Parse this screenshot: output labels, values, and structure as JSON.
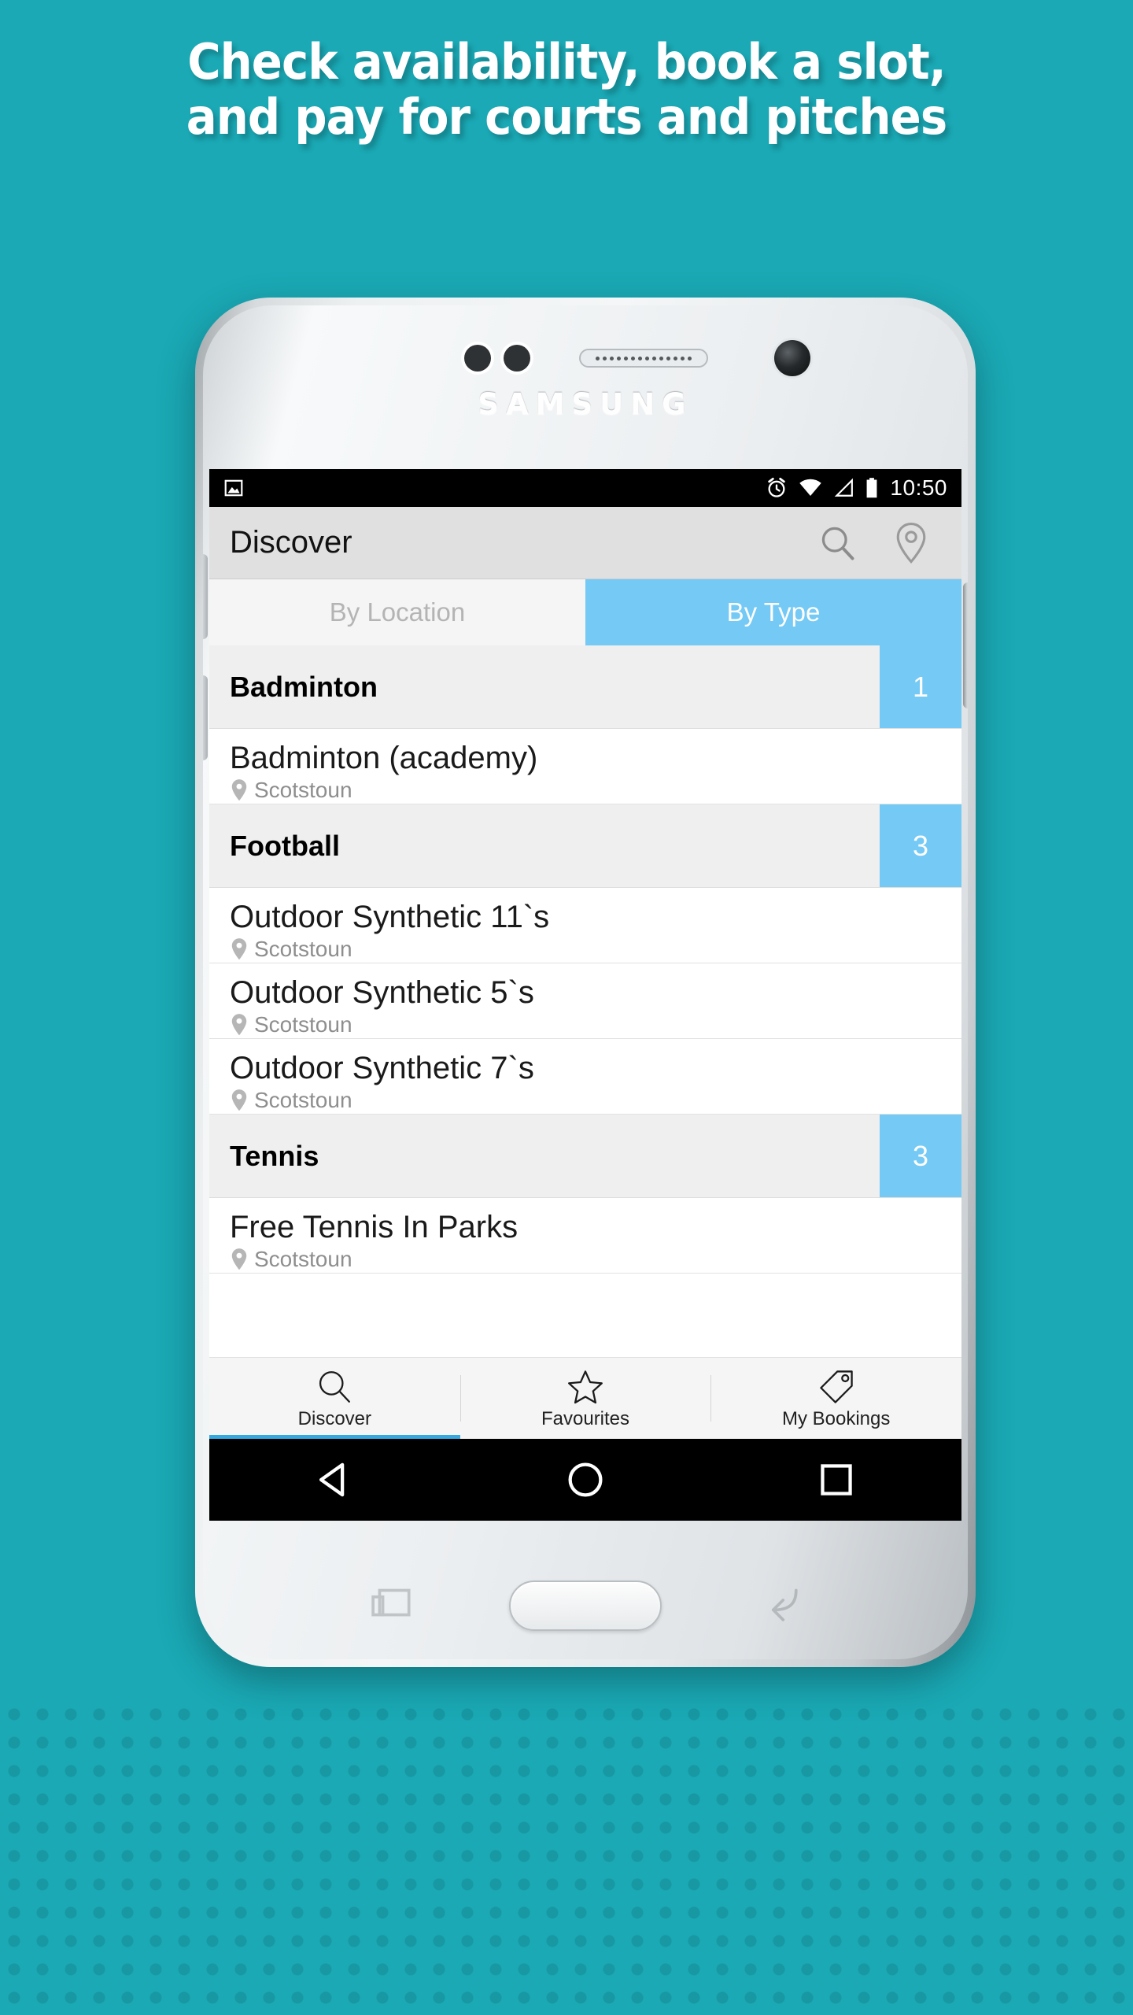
{
  "promo": {
    "background_color": "#1aa9b5",
    "headline_line_1": "Check availability, book a slot,",
    "headline_line_2": "and pay for courts and pitches"
  },
  "device": {
    "brand": "SAMSUNG"
  },
  "statusbar": {
    "time": "10:50",
    "icons": [
      "image-icon",
      "alarm-icon",
      "wifi-icon",
      "signal-icon",
      "battery-icon"
    ]
  },
  "appbar": {
    "title": "Discover",
    "actions": [
      "search-icon",
      "location-pin-icon"
    ]
  },
  "tabs": {
    "items": [
      {
        "label": "By Location",
        "active": false
      },
      {
        "label": "By Type",
        "active": true
      }
    ],
    "active_color": "#74c9f5",
    "inactive_color": "#f5f5f5"
  },
  "list": {
    "sections": [
      {
        "title": "Badminton",
        "count": "1",
        "items": [
          {
            "title": "Badminton (academy)",
            "location": "Scotstoun"
          }
        ]
      },
      {
        "title": "Football",
        "count": "3",
        "items": [
          {
            "title": "Outdoor Synthetic 11`s",
            "location": "Scotstoun"
          },
          {
            "title": "Outdoor Synthetic 5`s",
            "location": "Scotstoun"
          },
          {
            "title": "Outdoor Synthetic 7`s",
            "location": "Scotstoun"
          }
        ]
      },
      {
        "title": "Tennis",
        "count": "3",
        "items": [
          {
            "title": "Free Tennis In Parks",
            "location": "Scotstoun"
          }
        ]
      }
    ]
  },
  "bottomnav": {
    "items": [
      {
        "label": "Discover",
        "icon": "search-icon",
        "selected": true
      },
      {
        "label": "Favourites",
        "icon": "star-icon",
        "selected": false
      },
      {
        "label": "My Bookings",
        "icon": "tag-icon",
        "selected": false
      }
    ],
    "indicator_color": "#35a8e0"
  },
  "androidnav": {
    "buttons": [
      "back-button",
      "home-button",
      "recents-button"
    ]
  }
}
